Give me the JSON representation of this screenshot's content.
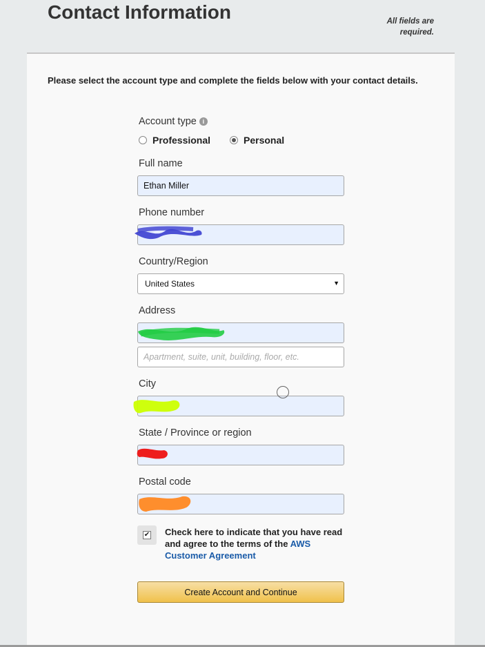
{
  "header": {
    "title": "Contact Information",
    "required_note": "All fields are required."
  },
  "intro": "Please select the account type and complete the fields below with your contact details.",
  "account_type": {
    "label": "Account type",
    "info_icon": "info-icon",
    "options": [
      {
        "label": "Professional",
        "selected": false
      },
      {
        "label": "Personal",
        "selected": true
      }
    ]
  },
  "full_name": {
    "label": "Full name",
    "value": "Ethan Miller"
  },
  "phone": {
    "label": "Phone number",
    "value": ""
  },
  "country": {
    "label": "Country/Region",
    "selected": "United States"
  },
  "address": {
    "label": "Address",
    "line1_value": "",
    "line2_placeholder": "Apartment, suite, unit, building, floor, etc."
  },
  "city": {
    "label": "City",
    "value": ""
  },
  "state": {
    "label": "State / Province or region",
    "value": ""
  },
  "postal": {
    "label": "Postal code",
    "value": ""
  },
  "agreement": {
    "checked": true,
    "text": "Check here to indicate that you have read and agree to the terms of the",
    "link": "AWS Customer Agreement"
  },
  "submit_label": "Create Account and Continue",
  "colors": {
    "field_fill": "#e8f0fe",
    "button": "#f0c14b",
    "link": "#1a5ba8",
    "redaction_phone": "#3b3fd0",
    "redaction_address": "#22cc44",
    "redaction_city": "#ccff00",
    "redaction_state": "#ee1111",
    "redaction_postal": "#ff8822"
  }
}
